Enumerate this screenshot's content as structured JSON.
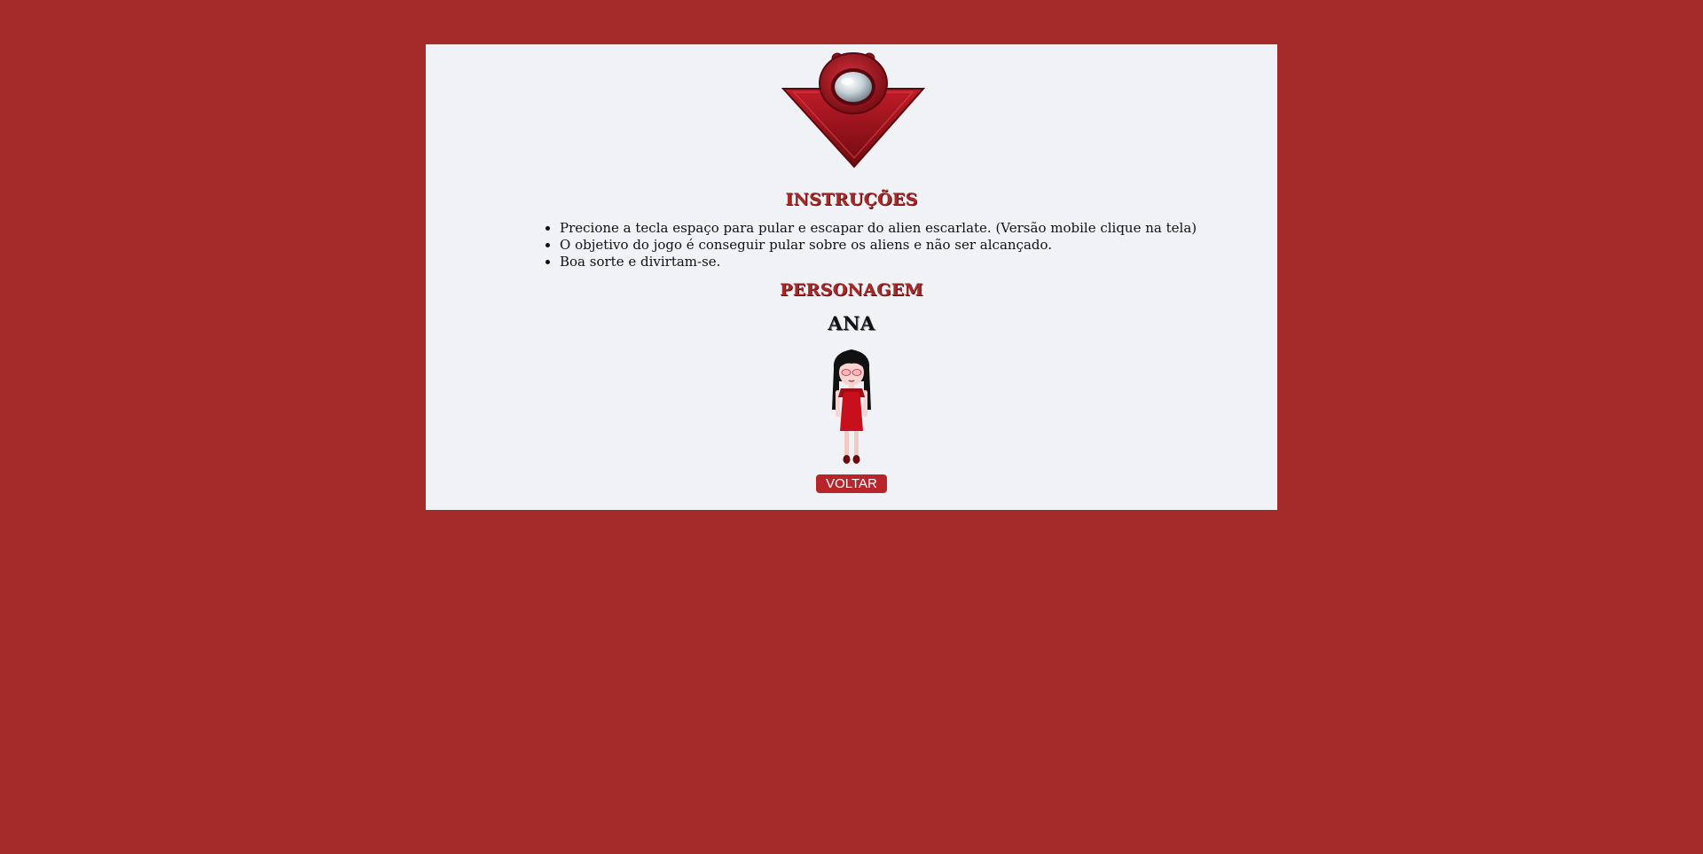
{
  "colors": {
    "page_background": "#a52a2a",
    "panel_background": "#f1f2f6",
    "accent": "#a52a2a",
    "button": "#b8242a",
    "button_text": "#ffffff"
  },
  "logo": {
    "icon": "red-alien-ship-logo-icon"
  },
  "instructions": {
    "title": "INSTRUÇÕES",
    "items": [
      "Precione a tecla espaço para pular e escapar do alien escarlate. (Versão mobile clique na tela)",
      "O objetivo do jogo é conseguir pular sobre os aliens e não ser alcançado.",
      "Boa sorte e divirtam-se."
    ]
  },
  "character": {
    "title": "PERSONAGEM",
    "name": "ANA",
    "icon": "character-ana-icon"
  },
  "back_button": {
    "label": "VOLTAR"
  }
}
